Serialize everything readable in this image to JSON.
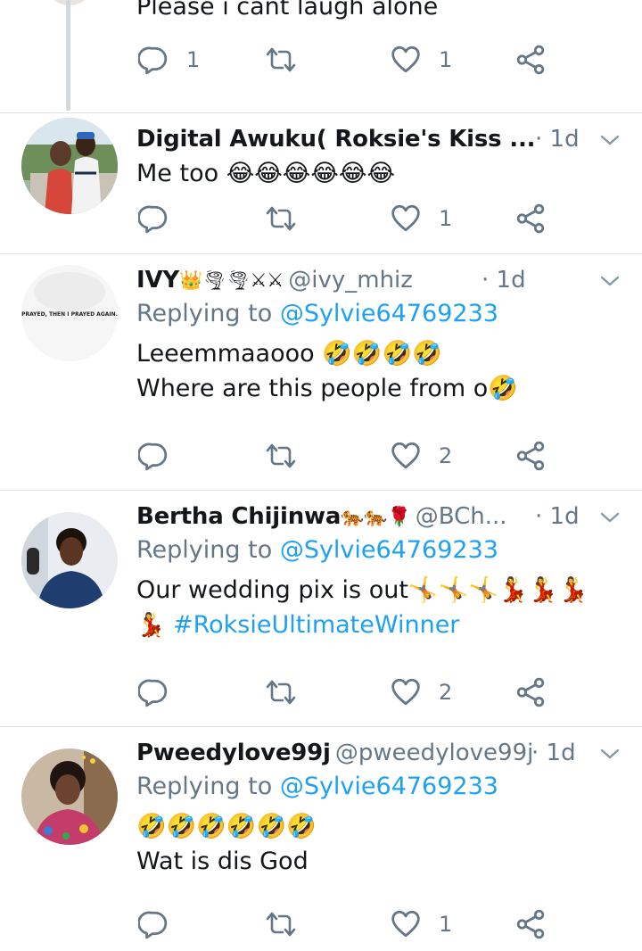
{
  "colors": {
    "link": "#1da1f2",
    "muted": "#657786",
    "text": "#14171a",
    "divider": "#dfe3e6"
  },
  "icons": {
    "reply": "reply-bubble-icon",
    "retweet": "retweet-icon",
    "like": "heart-icon",
    "share": "share-icon",
    "more": "chevron-down-icon"
  },
  "top": {
    "text": "Please i cant laugh alone",
    "reply_count": "1",
    "like_count": "1"
  },
  "tweets": [
    {
      "name": "Digital Awuku( Roksie's Kiss ...",
      "handle": "",
      "time": "· 1d",
      "reply_to_prefix": "",
      "reply_to_user": "",
      "lines": [
        "Me too 😂😂😂😂😂😂"
      ],
      "reply_count": "",
      "like_count": "1"
    },
    {
      "name": "IVY",
      "name_emoji": "👑🌪🌪⚔⚔",
      "handle": "@ivy_mhiz",
      "time": "· 1d",
      "reply_to_prefix": "Replying to",
      "reply_to_user": "@Sylvie64769233",
      "lines": [
        "Leeemmaaooo 🤣🤣🤣🤣",
        "Where are this people from o🤣"
      ],
      "reply_count": "",
      "like_count": "2",
      "avatar_text": "PRAYED, THEN I PRAYED AGAIN."
    },
    {
      "name": "Bertha Chijinwa",
      "name_emoji": "🐅🐅🌹",
      "handle": "@BCh...",
      "time": "· 1d",
      "reply_to_prefix": "Replying to",
      "reply_to_user": "@Sylvie64769233",
      "lines": [
        "Our wedding pix is out🤸🤸🤸💃💃💃"
      ],
      "line2_emoji": "💃",
      "hashtag": "#RoksieUltimateWinner",
      "reply_count": "",
      "like_count": "2"
    },
    {
      "name": "Pweedylove99j",
      "handle": "@pweedylove99j",
      "time": "· 1d",
      "reply_to_prefix": "Replying to",
      "reply_to_user": "@Sylvie64769233",
      "lines": [
        "🤣🤣🤣🤣🤣🤣",
        "Wat is dis God"
      ],
      "reply_count": "",
      "like_count": "1"
    }
  ]
}
